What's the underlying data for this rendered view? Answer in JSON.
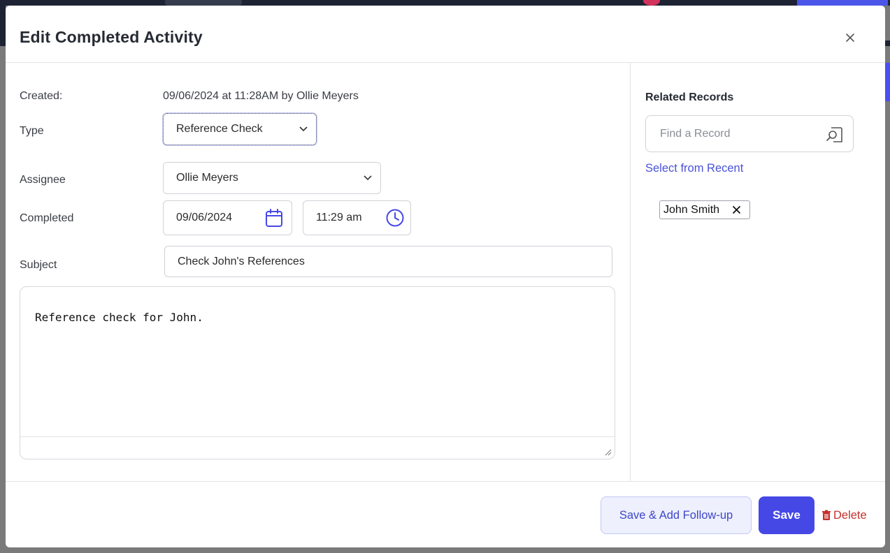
{
  "modal": {
    "title": "Edit Completed Activity"
  },
  "form": {
    "created_label": "Created:",
    "created_value": "09/06/2024 at 11:28AM by Ollie Meyers",
    "type_label": "Type",
    "type_value": "Reference Check",
    "assignee_label": "Assignee",
    "assignee_value": "Ollie Meyers",
    "completed_label": "Completed",
    "completed_date": "09/06/2024",
    "completed_time": "11:29 am",
    "subject_label": "Subject",
    "subject_value": "Check John's References",
    "notes_value": "Reference check for John."
  },
  "related": {
    "title": "Related Records",
    "search_placeholder": "Find a Record",
    "recent_link": "Select from Recent",
    "records": [
      "John Smith"
    ]
  },
  "footer": {
    "followup_label": "Save & Add Follow-up",
    "save_label": "Save",
    "delete_label": "Delete"
  },
  "colors": {
    "accent": "#4648e6",
    "link": "#4a52d8",
    "delete": "#c4312c"
  },
  "icons": [
    "close-icon",
    "chevron-down-icon",
    "calendar-icon",
    "clock-icon",
    "search-record-icon",
    "remove-icon",
    "trash-icon",
    "resize-grip-icon"
  ]
}
